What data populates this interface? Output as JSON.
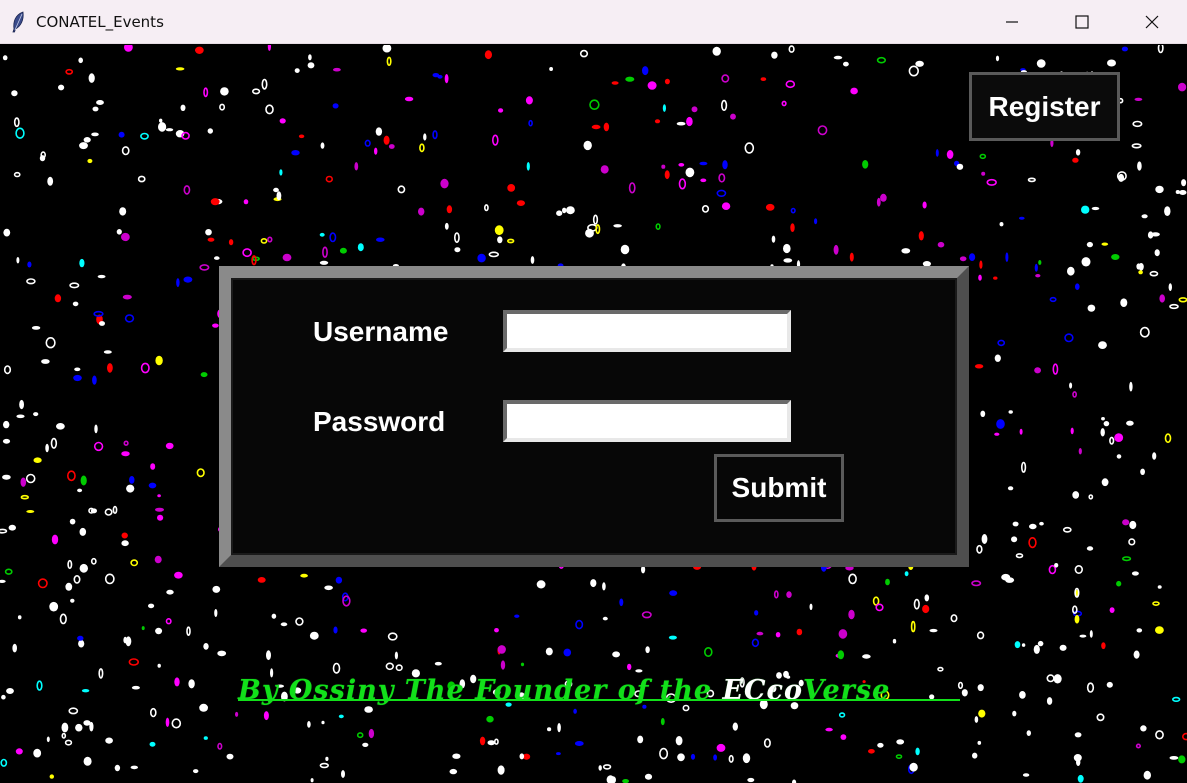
{
  "window": {
    "title": "CONATEL_Events",
    "icon": "feather-icon",
    "controls": [
      "minimize-icon",
      "maximize-icon",
      "close-icon"
    ]
  },
  "header": {
    "register_label": "Register"
  },
  "login": {
    "username_label": "Username",
    "username_value": "",
    "password_label": "Password",
    "password_value": "",
    "submit_label": "Submit"
  },
  "footer": {
    "prefix": "By Ossiny The Founder of the ",
    "accent": "ECco",
    "suffix": "Verse"
  },
  "colors": {
    "background": "#000000",
    "footer_text": "#12e01a",
    "frame_border": "#6e6e6e",
    "speckle_palette": [
      "#ffffff",
      "#ff0000",
      "#ff00ff",
      "#0000ff",
      "#cc00cc",
      "#00ffff",
      "#ffff00",
      "#00cc00"
    ]
  }
}
